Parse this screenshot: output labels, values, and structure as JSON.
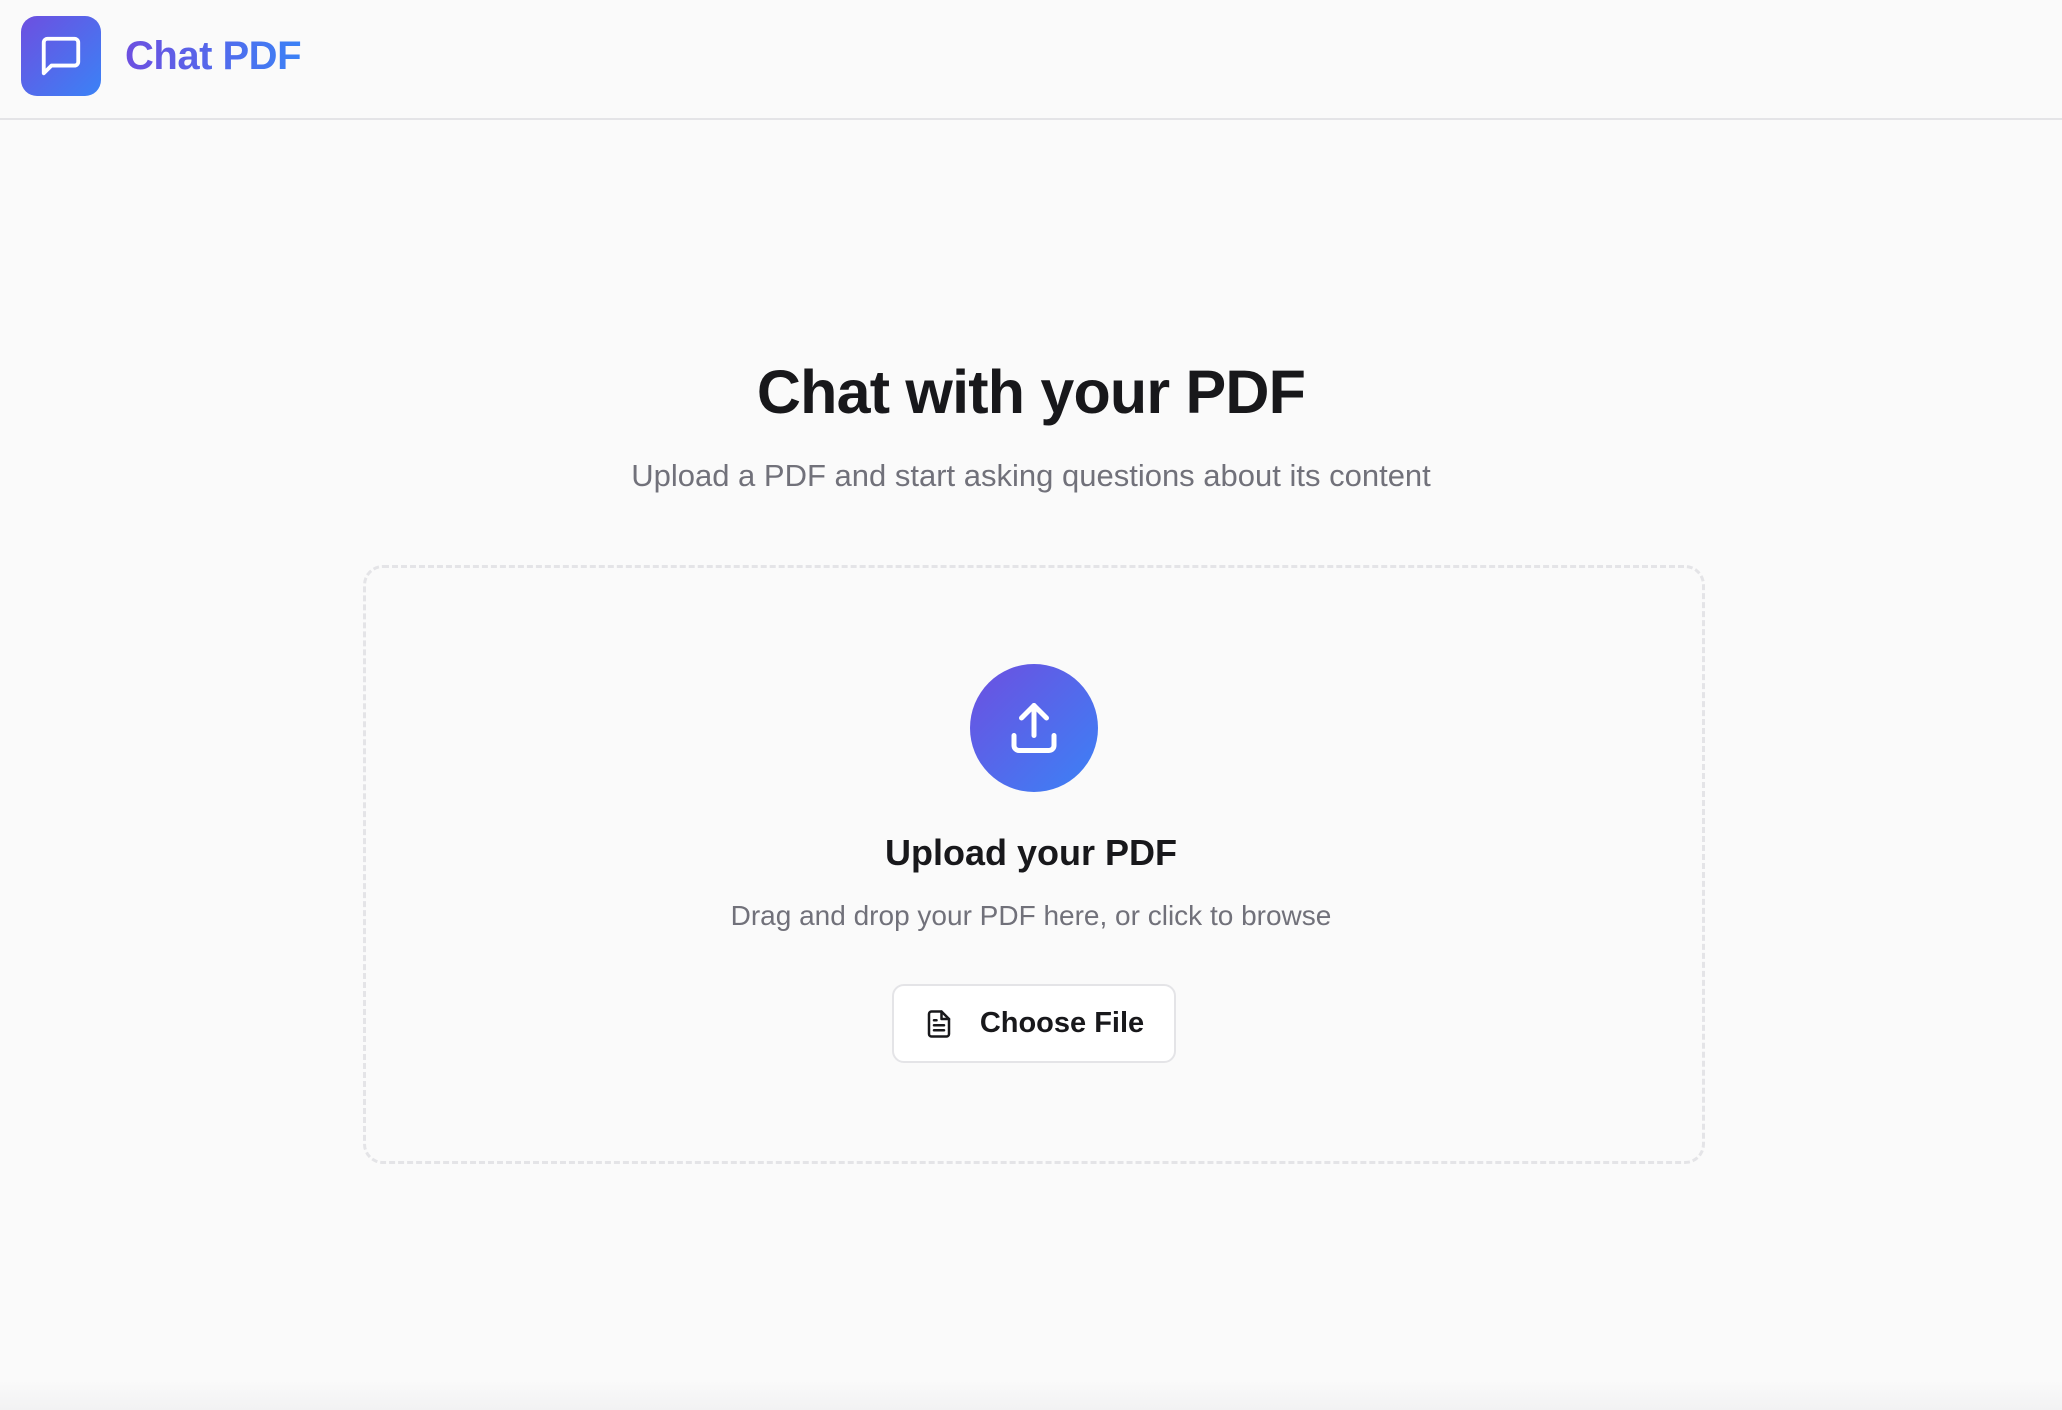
{
  "header": {
    "brand_name": "Chat PDF",
    "logo_icon": "message-square-icon"
  },
  "hero": {
    "title": "Chat with your PDF",
    "subtitle": "Upload a PDF and start asking questions about its content"
  },
  "upload": {
    "icon": "upload-icon",
    "title": "Upload your PDF",
    "hint": "Drag and drop your PDF here, or click to browse",
    "button_label": "Choose File",
    "button_icon": "file-text-icon"
  },
  "colors": {
    "gradient_start": "#6d4fe0",
    "gradient_end": "#3b82f6",
    "background": "#fafafa",
    "text_primary": "#18181b",
    "text_muted": "#71717a",
    "border": "#e4e4e7"
  }
}
